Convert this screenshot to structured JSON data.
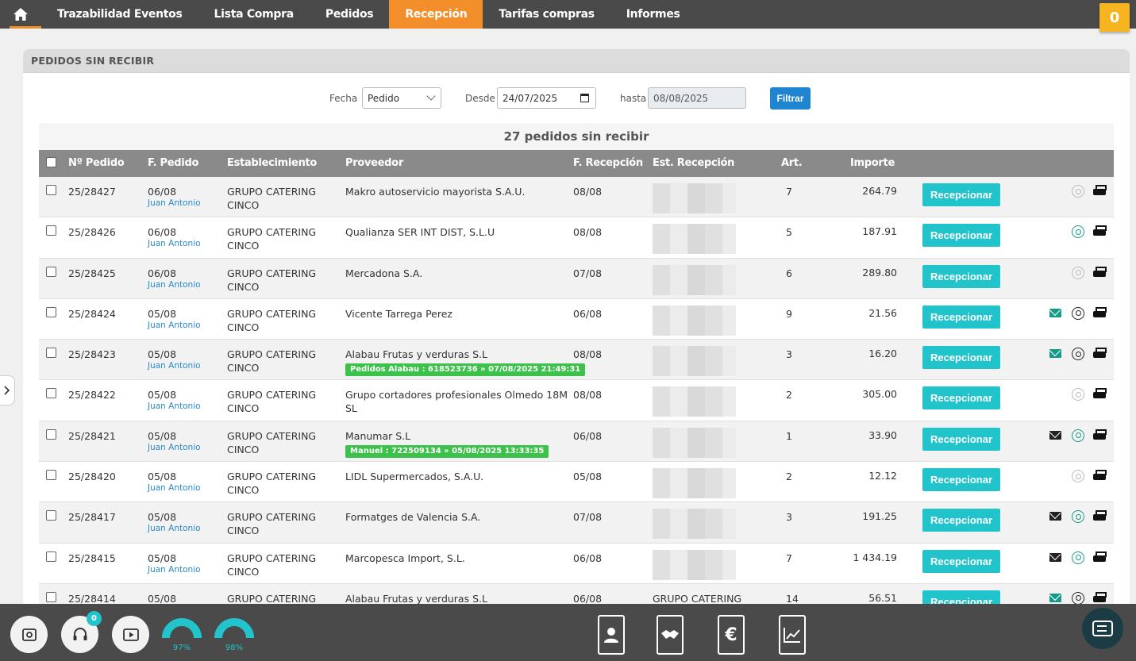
{
  "nav": {
    "items": [
      "Trazabilidad Eventos",
      "Lista Compra",
      "Pedidos",
      "Recepción",
      "Tarifas compras",
      "Informes"
    ],
    "active": "Recepción",
    "cart_count": "0"
  },
  "panel": {
    "title": "PEDIDOS SIN RECIBIR"
  },
  "filters": {
    "fecha_label": "Fecha",
    "fecha_value": "Pedido",
    "desde_label": "Desde",
    "desde_value": "24/07/2025",
    "hasta_label": "hasta",
    "hasta_value": "08/08/2025",
    "button": "Filtrar"
  },
  "table": {
    "count_label": "27 pedidos sin recibir",
    "headers": [
      "Nº Pedido",
      "F. Pedido",
      "Establecimiento",
      "Proveedor",
      "F. Recepción",
      "Est. Recepción",
      "Art.",
      "Importe"
    ],
    "button_label": "Recepcionar",
    "rows": [
      {
        "num": "25/28427",
        "fecha": "06/08",
        "user": "Juan Antonio",
        "est1": "GRUPO CATERING",
        "est2": "CINCO",
        "prov": "Makro autoservicio mayorista S.A.U.",
        "prov2": "",
        "tag": "",
        "frec": "08/08",
        "estrec": "",
        "art": "7",
        "importe": "264.79",
        "mail": "",
        "wa": "grey"
      },
      {
        "num": "25/28426",
        "fecha": "06/08",
        "user": "Juan Antonio",
        "est1": "GRUPO CATERING",
        "est2": "CINCO",
        "prov": "Qualianza SER INT DIST, S.L.U",
        "prov2": "",
        "tag": "",
        "frec": "08/08",
        "estrec": "",
        "art": "5",
        "importe": "187.91",
        "mail": "",
        "wa": "green"
      },
      {
        "num": "25/28425",
        "fecha": "06/08",
        "user": "Juan Antonio",
        "est1": "GRUPO CATERING",
        "est2": "CINCO",
        "prov": "Mercadona S.A.",
        "prov2": "",
        "tag": "",
        "frec": "07/08",
        "estrec": "",
        "art": "6",
        "importe": "289.80",
        "mail": "",
        "wa": "grey"
      },
      {
        "num": "25/28424",
        "fecha": "05/08",
        "user": "Juan Antonio",
        "est1": "GRUPO CATERING",
        "est2": "CINCO",
        "prov": "Vicente Tarrega Perez",
        "prov2": "",
        "tag": "",
        "frec": "06/08",
        "estrec": "",
        "art": "9",
        "importe": "21.56",
        "mail": "green",
        "wa": "black"
      },
      {
        "num": "25/28423",
        "fecha": "05/08",
        "user": "Juan Antonio",
        "est1": "GRUPO CATERING",
        "est2": "CINCO",
        "prov": "Alabau Frutas y verduras S.L",
        "prov2": "",
        "tag": "Pedidos Alabau : 618523736 » 07/08/2025 21:49:31",
        "frec": "08/08",
        "estrec": "",
        "art": "3",
        "importe": "16.20",
        "mail": "green",
        "wa": "black"
      },
      {
        "num": "25/28422",
        "fecha": "05/08",
        "user": "Juan Antonio",
        "est1": "GRUPO CATERING",
        "est2": "CINCO",
        "prov": "Grupo cortadores profesionales Olmedo 18M",
        "prov2": "SL",
        "tag": "",
        "frec": "08/08",
        "estrec": "",
        "art": "2",
        "importe": "305.00",
        "mail": "",
        "wa": "grey"
      },
      {
        "num": "25/28421",
        "fecha": "05/08",
        "user": "Juan Antonio",
        "est1": "GRUPO CATERING",
        "est2": "CINCO",
        "prov": "Manumar S.L",
        "prov2": "",
        "tag": "Manuel : 722509134 » 05/08/2025 13:33:35",
        "frec": "06/08",
        "estrec": "",
        "art": "1",
        "importe": "33.90",
        "mail": "black",
        "wa": "green"
      },
      {
        "num": "25/28420",
        "fecha": "05/08",
        "user": "Juan Antonio",
        "est1": "GRUPO CATERING",
        "est2": "CINCO",
        "prov": "LIDL Supermercados, S.A.U.",
        "prov2": "",
        "tag": "",
        "frec": "05/08",
        "estrec": "",
        "art": "2",
        "importe": "12.12",
        "mail": "",
        "wa": "grey"
      },
      {
        "num": "25/28417",
        "fecha": "05/08",
        "user": "Juan Antonio",
        "est1": "GRUPO CATERING",
        "est2": "CINCO",
        "prov": "Formatges de Valencia S.A.",
        "prov2": "",
        "tag": "",
        "frec": "07/08",
        "estrec": "",
        "art": "3",
        "importe": "191.25",
        "mail": "black",
        "wa": "green"
      },
      {
        "num": "25/28415",
        "fecha": "05/08",
        "user": "Juan Antonio",
        "est1": "GRUPO CATERING",
        "est2": "CINCO",
        "prov": "Marcopesca Import, S.L.",
        "prov2": "",
        "tag": "",
        "frec": "06/08",
        "estrec": "",
        "art": "7",
        "importe": "1 434.19",
        "mail": "black",
        "wa": "green"
      },
      {
        "num": "25/28414",
        "fecha": "05/08",
        "user": "",
        "est1": "GRUPO CATERING",
        "est2": "",
        "prov": "Alabau Frutas y verduras S.L",
        "prov2": "",
        "tag": "",
        "frec": "06/08",
        "estrec": "GRUPO CATERING",
        "art": "14",
        "importe": "56.51",
        "mail": "green",
        "wa": "black"
      }
    ]
  },
  "bottom": {
    "support_badge": "0",
    "gauge1": "97%",
    "gauge2": "98%",
    "gauge1_value": 0.97,
    "gauge2_value": 0.98
  },
  "colors": {
    "nav_bg": "#4a4a4a",
    "accent": "#f28f2b",
    "teal": "#22c4cc",
    "filter_blue": "#1f85d0"
  }
}
